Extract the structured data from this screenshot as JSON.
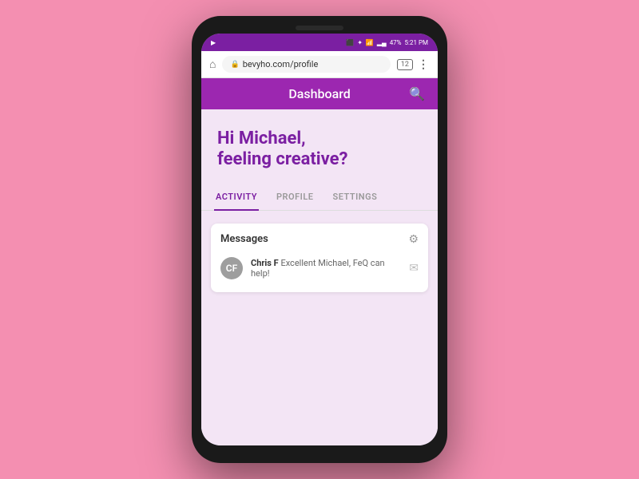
{
  "phone": {
    "status_bar": {
      "battery": "47%",
      "time": "5:21 PM",
      "signal": "▂▄▆",
      "wifi": "WiFi",
      "bluetooth": "BT"
    },
    "browser": {
      "url": "bevyho.com/profile",
      "tab_count": "12"
    },
    "app": {
      "title": "Dashboard",
      "greeting_line1": "Hi Michael,",
      "greeting_line2": "feeling creative?"
    },
    "tabs": [
      {
        "label": "ACTIVITY",
        "active": true
      },
      {
        "label": "PROFILE",
        "active": false
      },
      {
        "label": "SETTINGS",
        "active": false
      }
    ],
    "messages": {
      "title": "Messages",
      "items": [
        {
          "sender": "Chris F",
          "preview": "Excellent Michael, FeQ can help!",
          "avatar_initials": "CF"
        }
      ]
    }
  }
}
